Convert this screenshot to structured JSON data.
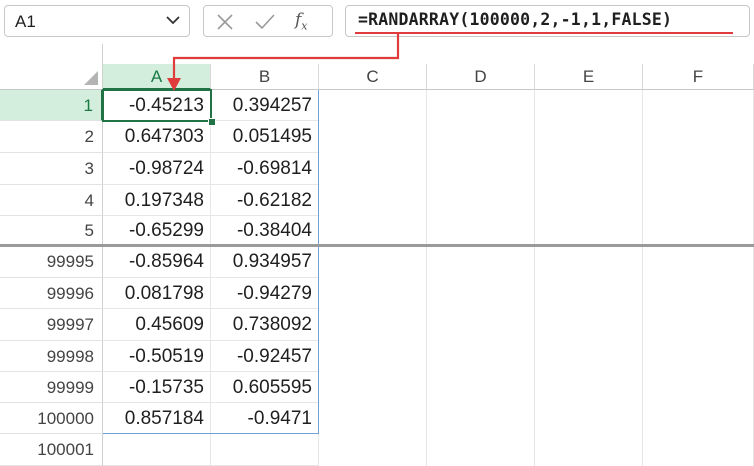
{
  "namebox": {
    "value": "A1"
  },
  "formula_bar": {
    "cancel_icon": "close-icon",
    "enter_icon": "check-icon",
    "fx_label": "fx",
    "formula": "=RANDARRAY(100000,2,-1,1,FALSE)"
  },
  "columns": [
    "A",
    "B",
    "C",
    "D",
    "E",
    "F"
  ],
  "top_rows": [
    {
      "row": "1",
      "a": "-0.45213",
      "b": "0.394257"
    },
    {
      "row": "2",
      "a": "0.647303",
      "b": "0.051495"
    },
    {
      "row": "3",
      "a": "-0.98724",
      "b": "-0.69814"
    },
    {
      "row": "4",
      "a": "0.197348",
      "b": "-0.62182"
    },
    {
      "row": "5",
      "a": "-0.65299",
      "b": "-0.38404"
    }
  ],
  "bottom_rows": [
    {
      "row": "99995",
      "a": "-0.85964",
      "b": "0.934957"
    },
    {
      "row": "99996",
      "a": "0.081798",
      "b": "-0.94279"
    },
    {
      "row": "99997",
      "a": "0.45609",
      "b": "0.738092"
    },
    {
      "row": "99998",
      "a": "-0.50519",
      "b": "-0.92457"
    },
    {
      "row": "99999",
      "a": "-0.15735",
      "b": "0.605595"
    },
    {
      "row": "100000",
      "a": "0.857184",
      "b": "-0.9471"
    },
    {
      "row": "100001",
      "a": "",
      "b": ""
    }
  ],
  "colors": {
    "accent": "#217346",
    "annotation": "#e03c3c",
    "spill_border": "#6fa0d8"
  }
}
